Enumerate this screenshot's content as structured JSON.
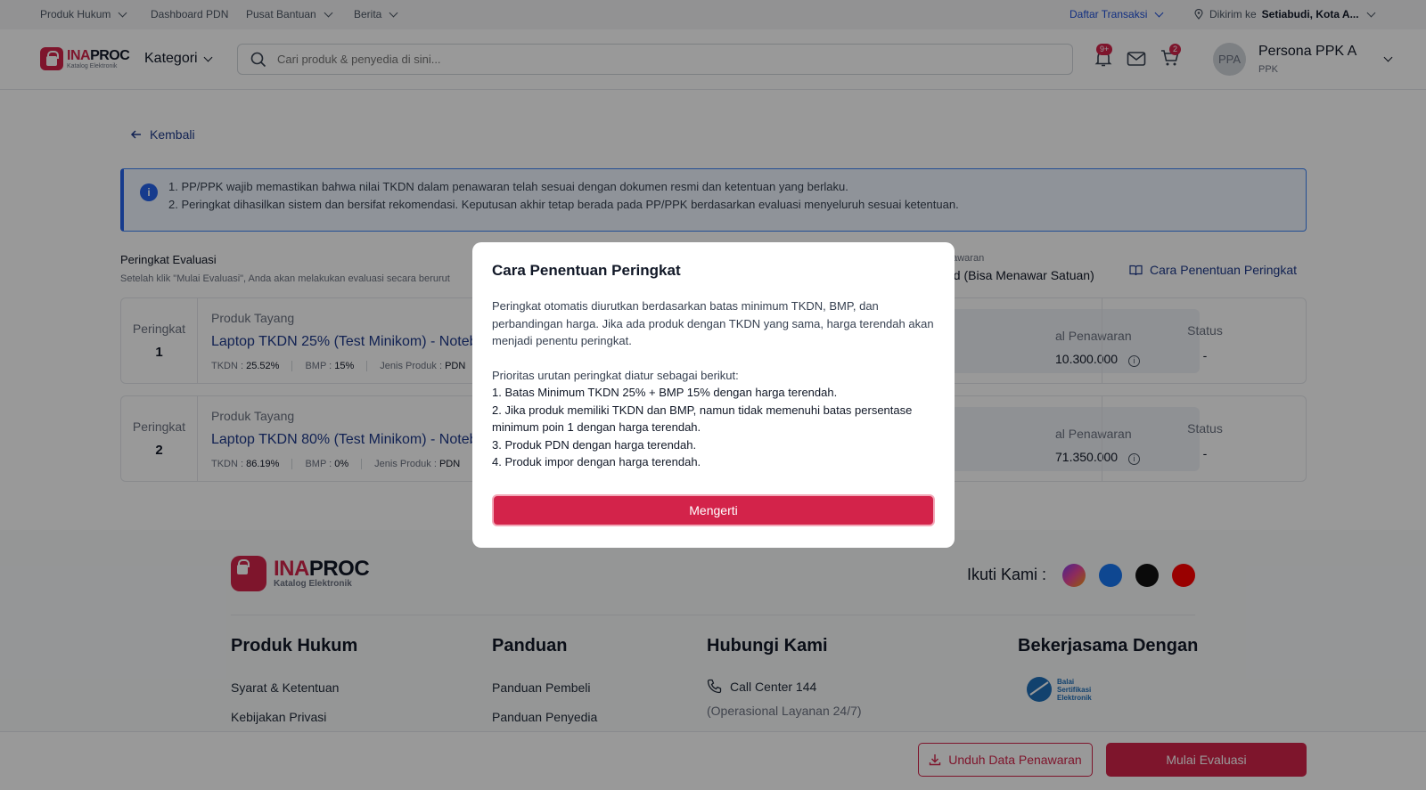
{
  "topbar": {
    "links": [
      "Produk Hukum",
      "Dashboard PDN",
      "Pusat Bantuan",
      "Berita"
    ],
    "transaction": "Daftar Transaksi",
    "ship_prefix": "Dikirim ke",
    "ship_location": "Setiabudi, Kota A..."
  },
  "header": {
    "logo_main_a": "INA",
    "logo_main_b": "PROC",
    "logo_sub": "Katalog Elektronik",
    "category": "Kategori",
    "search_placeholder": "Cari produk & penyedia di sini...",
    "notif_badge": "9+",
    "cart_badge": "2",
    "avatar_initials": "PPA",
    "user_name": "Persona PPK A",
    "user_role": "PPK"
  },
  "back": "Kembali",
  "info": {
    "line1": "1. PP/PPK wajib memastikan bahwa nilai TKDN dalam penawaran telah sesuai dengan dokumen resmi dan ketentuan yang berlaku.",
    "line2": "2. Peringkat dihasilkan sistem dan bersifat rekomendasi. Keputusan akhir tetap berada pada PP/PPK berdasarkan evaluasi menyeluruh sesuai ketentuan."
  },
  "eval": {
    "title": "Peringkat Evaluasi",
    "subtitle": "Setelah klik \"Mulai Evaluasi\", Anda akan melakukan evaluasi secara berurut",
    "offer_label": "nawaran",
    "offer_value": "ed (Bisa Menawar Satuan)",
    "howto_link": "Cara Penentuan Peringkat"
  },
  "rows": [
    {
      "rank_label": "Peringkat",
      "rank": "1",
      "status_label": "Produk Tayang",
      "title": "Laptop TKDN 25% (Test Minikom) - Noteb",
      "tkdn_label": "TKDN :",
      "tkdn": "25.52%",
      "bmp_label": "BMP :",
      "bmp": "15%",
      "jenis_label": "Jenis Produk :",
      "jenis": "PDN",
      "total_label": "al Penawaran",
      "total": "10.300.000",
      "stat_label": "Status",
      "stat": "-"
    },
    {
      "rank_label": "Peringkat",
      "rank": "2",
      "status_label": "Produk Tayang",
      "title": "Laptop TKDN 80% (Test Minikom) - Noteb",
      "tkdn_label": "TKDN :",
      "tkdn": "86.19%",
      "bmp_label": "BMP :",
      "bmp": "0%",
      "jenis_label": "Jenis Produk :",
      "jenis": "PDN",
      "total_label": "al Penawaran",
      "total": "71.350.000",
      "stat_label": "Status",
      "stat": "-"
    }
  ],
  "footer": {
    "follow": "Ikuti Kami :",
    "col1_title": "Produk Hukum",
    "col1_items": [
      "Syarat & Ketentuan",
      "Kebijakan Privasi"
    ],
    "col2_title": "Panduan",
    "col2_items": [
      "Panduan Pembeli",
      "Panduan Penyedia"
    ],
    "col3_title": "Hubungi Kami",
    "call_center": "Call Center 144",
    "hours": "(Operasional Layanan 24/7)",
    "col4_title": "Bekerjasama Dengan",
    "partner": [
      "Balai",
      "Sertifikasi",
      "Elektronik"
    ]
  },
  "actions": {
    "download": "Unduh Data Penawaran",
    "start": "Mulai Evaluasi"
  },
  "modal": {
    "title": "Cara Penentuan Peringkat",
    "intro": "Peringkat otomatis diurutkan berdasarkan batas minimum TKDN, BMP, dan perbandingan harga. Jika ada produk dengan TKDN yang sama, harga terendah akan menjadi penentu peringkat.",
    "priority": "Prioritas urutan peringkat diatur sebagai berikut:",
    "items": [
      "1. Batas Minimum TKDN 25% + BMP 15% dengan harga terendah.",
      "2. Jika produk memiliki TKDN dan BMP, namun tidak memenuhi batas persentase minimum poin 1 dengan harga terendah.",
      "3. Produk PDN dengan harga terendah.",
      "4. Produk impor dengan harga terendah."
    ],
    "button": "Mengerti"
  },
  "colors": {
    "brand": "#d3234a",
    "link": "#1e3a8a",
    "info": "#2563eb"
  }
}
